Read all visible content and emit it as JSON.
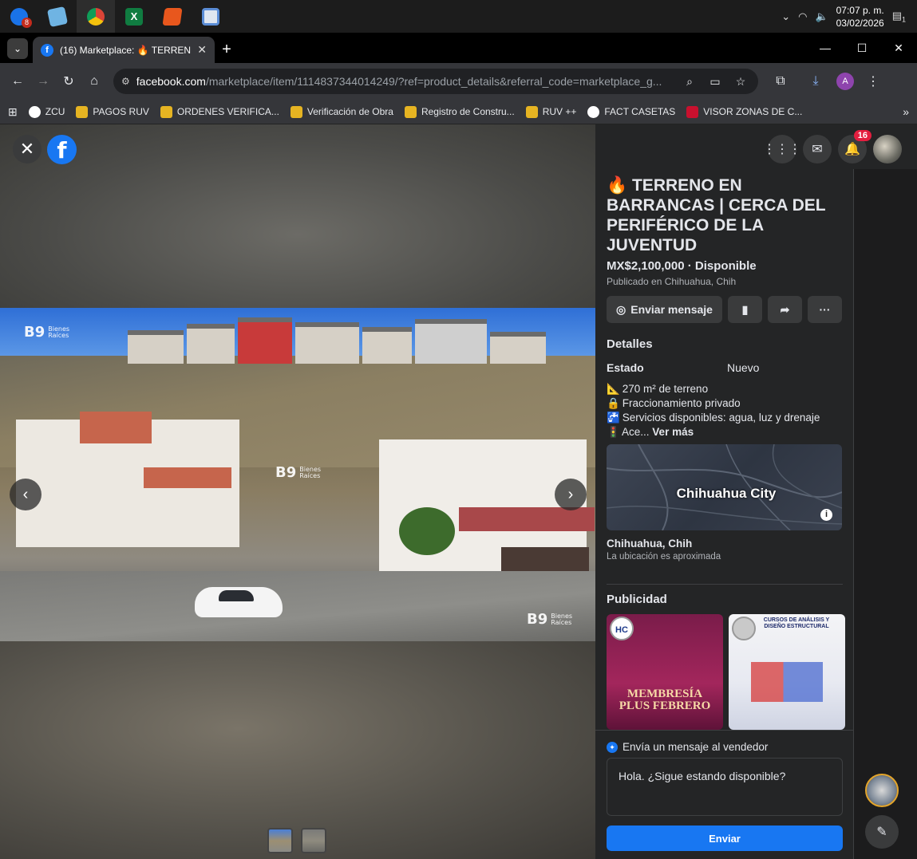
{
  "taskbar": {
    "apps": [
      {
        "name": "outlook",
        "color": "#1a73e8",
        "badge": "8"
      },
      {
        "name": "notepad",
        "color": "#6fb4e3",
        "badge": ""
      },
      {
        "name": "chrome",
        "color": "#db4437",
        "badge": ""
      },
      {
        "name": "excel",
        "color": "#107c41",
        "badge": ""
      },
      {
        "name": "office",
        "color": "#e8571d",
        "badge": ""
      },
      {
        "name": "remote-desktop",
        "color": "#5b8dd6",
        "badge": ""
      }
    ],
    "time": "07:07 p. m.",
    "date": "03/02/2026",
    "notifications": "1"
  },
  "browser": {
    "tab_title": "(16) Marketplace: 🔥 TERRENO EN BARRANCAS",
    "url_domain": "facebook.com",
    "url_path": "/marketplace/item/1114837344014249/?ref=product_details&referral_code=marketplace_g...",
    "profile_initial": "A",
    "bookmarks": [
      {
        "label": "ZCU",
        "color": "#ffffff"
      },
      {
        "label": "PAGOS RUV",
        "color": "#e6b422"
      },
      {
        "label": "ORDENES VERIFICA...",
        "color": "#e6b422"
      },
      {
        "label": "Verificación de Obra",
        "color": "#e6b422"
      },
      {
        "label": "Registro de Constru...",
        "color": "#e6b422"
      },
      {
        "label": "RUV ++",
        "color": "#e6b422"
      },
      {
        "label": "FACT CASETAS",
        "color": "#ffffff"
      },
      {
        "label": "VISOR ZONAS DE C...",
        "color": "#c8102e"
      }
    ]
  },
  "viewer": {
    "watermark_mark": "B9",
    "watermark_line1": "Bienes",
    "watermark_line2": "Raíces"
  },
  "facebook": {
    "notification_count": "16"
  },
  "listing": {
    "title": "🔥 TERRENO EN BARRANCAS | CERCA DEL PERIFÉRICO DE LA JUVENTUD",
    "price": "MX$2,100,000 · Disponible",
    "posted": "Publicado en Chihuahua, Chih",
    "message_button": "Enviar mensaje",
    "details_heading": "Detalles",
    "estado_label": "Estado",
    "estado_value": "Nuevo",
    "description": [
      {
        "emoji": "📐",
        "text": "270 m² de terreno"
      },
      {
        "emoji": "🔒",
        "text": "Fraccionamiento privado"
      },
      {
        "emoji": "🚰",
        "text": "Servicios disponibles: agua, luz y drenaje"
      },
      {
        "emoji": "🚦",
        "text": "Ace..."
      }
    ],
    "see_more": "Ver más",
    "map_label": "Chihuahua City",
    "location": "Chihuahua, Chih",
    "location_note": "La ubicación es aproximada",
    "ads_heading": "Publicidad",
    "ads": [
      {
        "badge": "HC",
        "headline": "MEMBRESÍA PLUS FEBRERO"
      },
      {
        "badge": "",
        "headline": "CURSOS DE ANÁLISIS Y DISEÑO ESTRUCTURAL"
      }
    ]
  },
  "compose": {
    "heading": "Envía un mensaje al vendedor",
    "message": "Hola. ¿Sigue estando disponible?",
    "send_label": "Enviar"
  }
}
